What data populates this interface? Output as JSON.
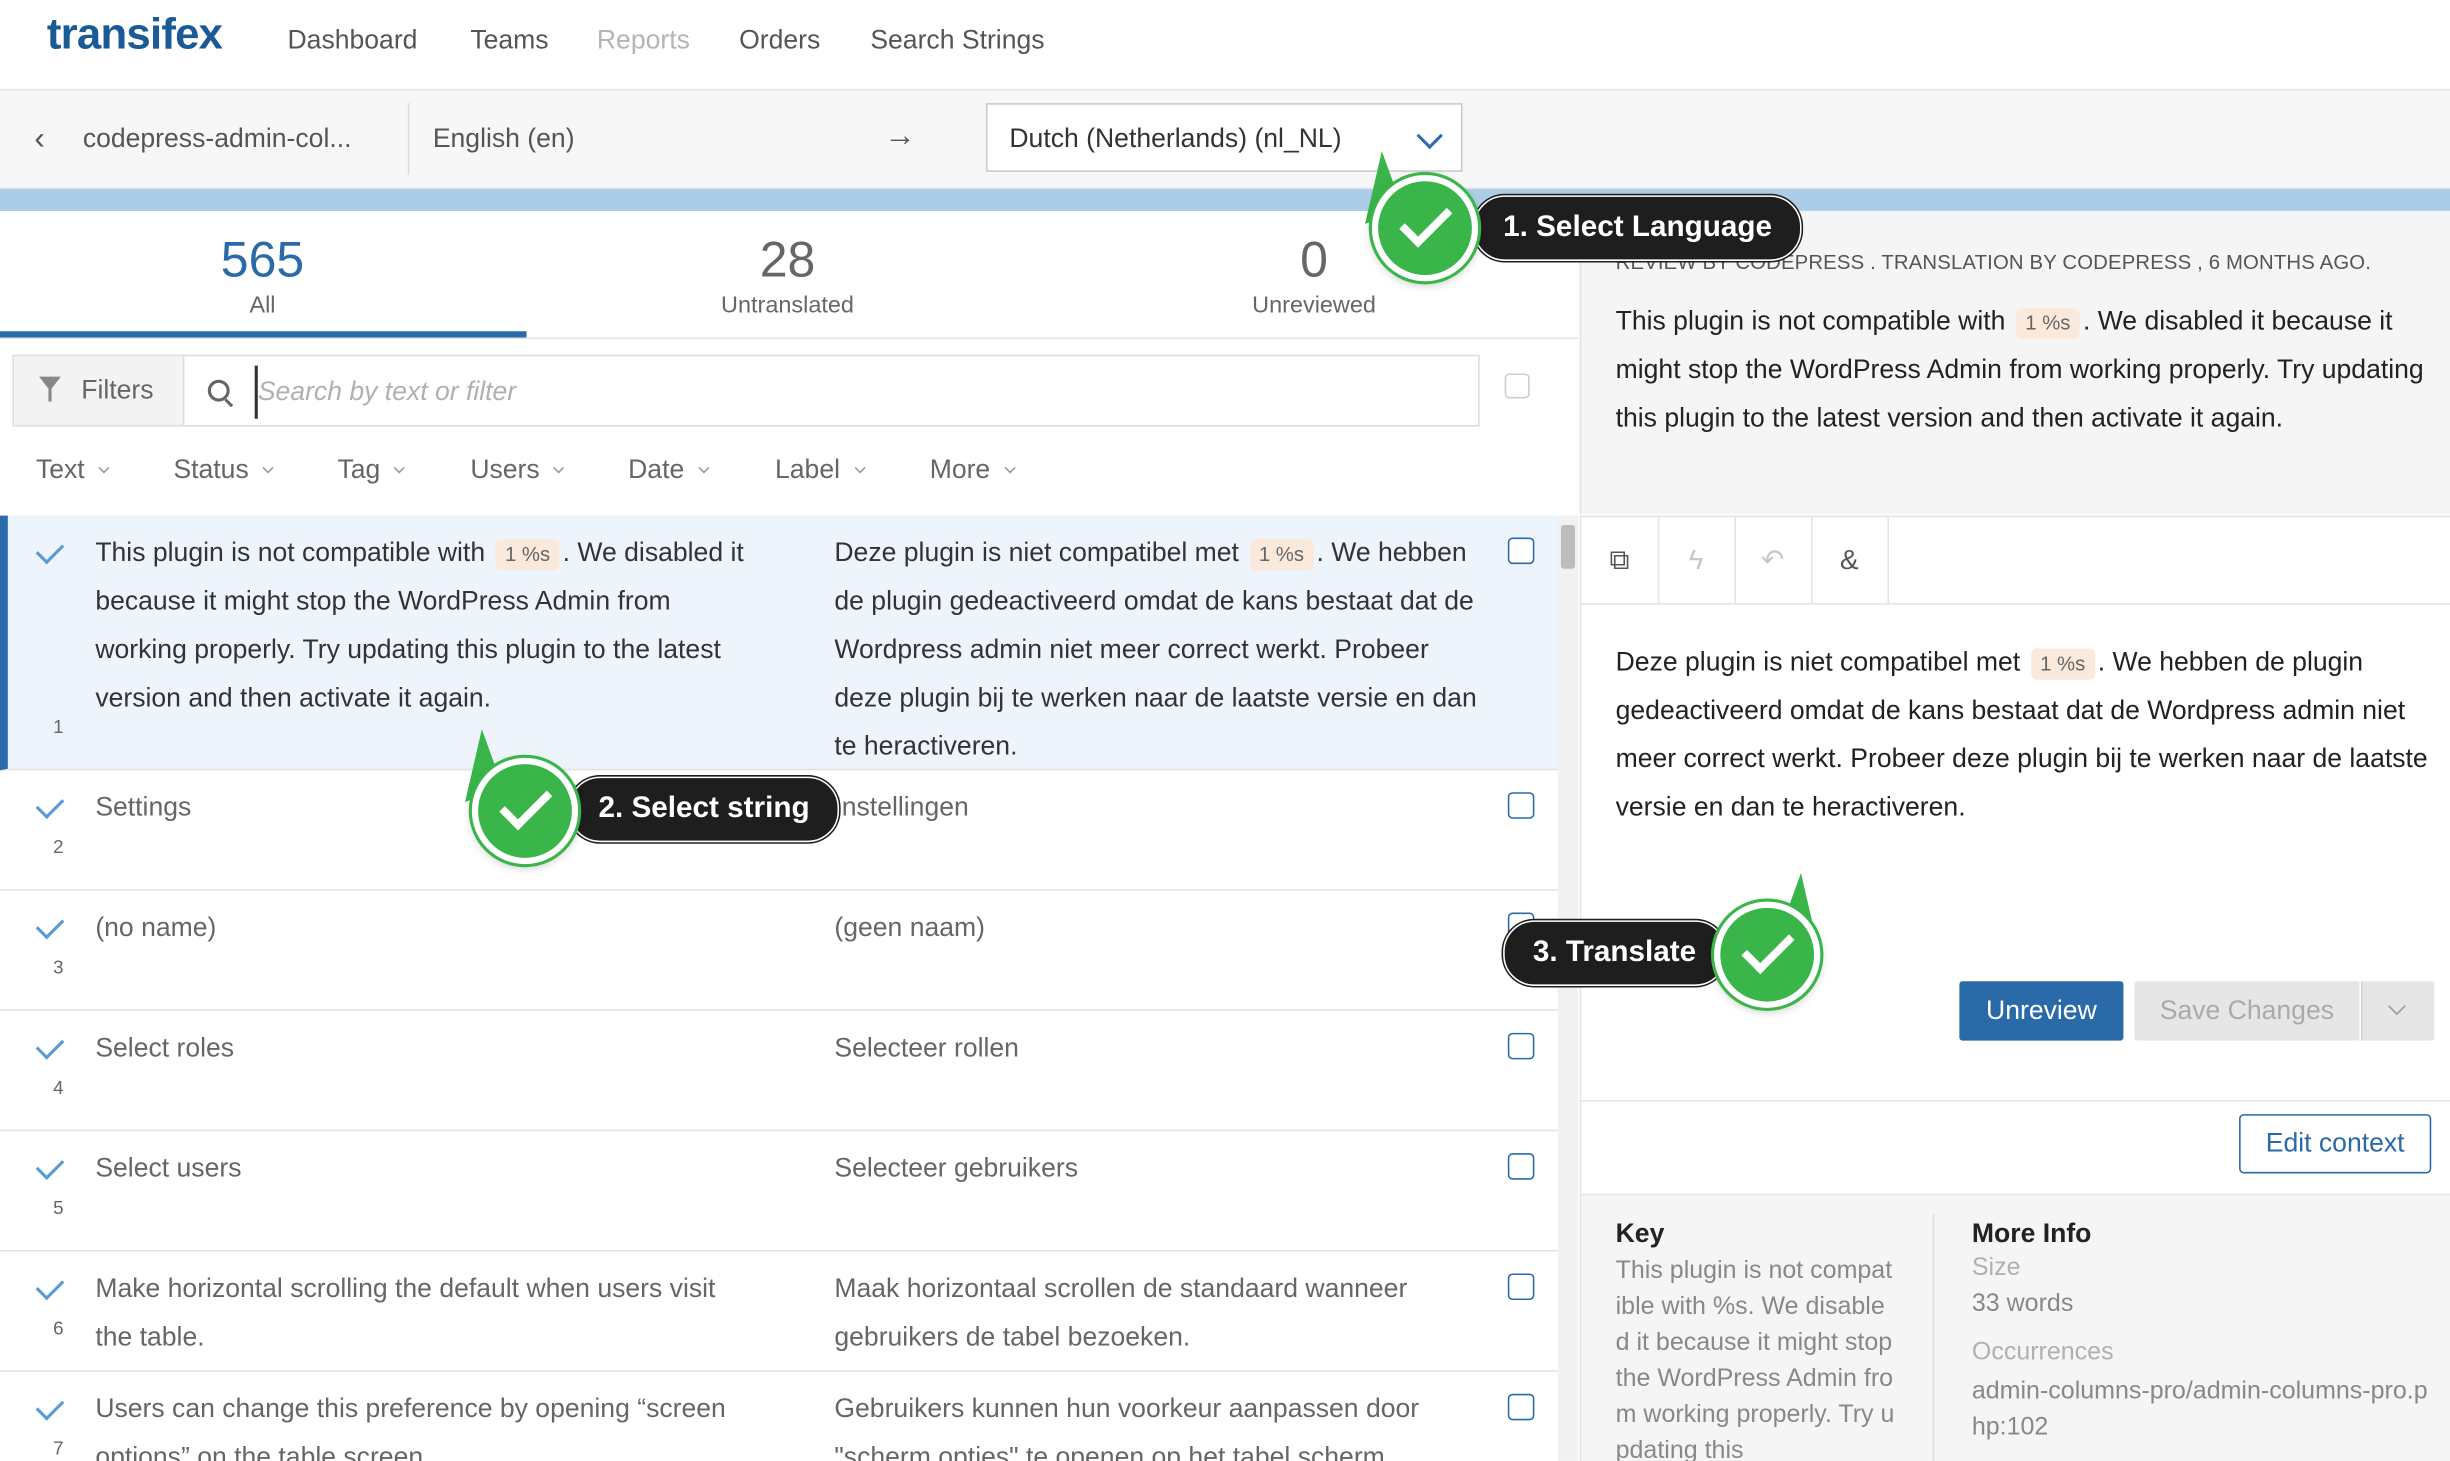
{
  "app": {
    "logo": "transifex",
    "nav": [
      "Dashboard",
      "Teams",
      "Reports",
      "Orders",
      "Search Strings"
    ]
  },
  "subbar": {
    "project": "codepress-admin-col...",
    "source_language": "English (en)",
    "arrow": "→",
    "target_language": "Dutch (Netherlands) (nl_NL)"
  },
  "tabs": [
    {
      "count": "565",
      "label": "All"
    },
    {
      "count": "28",
      "label": "Untranslated"
    },
    {
      "count": "0",
      "label": "Unreviewed"
    }
  ],
  "filters": {
    "button": "Filters",
    "search_placeholder": "Search by text or filter",
    "columns": [
      "Text",
      "Status",
      "Tag",
      "Users",
      "Date",
      "Label",
      "More"
    ]
  },
  "rows": [
    {
      "num": "1",
      "src_a": "This plugin is not compatible with ",
      "src_ph": "1 %s",
      "src_b": ". We disabled it because it might stop the WordPress Admin from working properly. Try updating this plugin to the latest version and then activate it again.",
      "trg_a": "Deze plugin is niet compatibel met ",
      "trg_ph": "1 %s",
      "trg_b": ". We hebben de plugin gedeactiveerd omdat de kans bestaat dat de Wordpress admin niet meer correct werkt. Probeer deze plugin bij te werken naar de laatste versie en dan te heractiveren."
    },
    {
      "num": "2",
      "src": "Settings",
      "trg": "Instellingen"
    },
    {
      "num": "3",
      "src": "(no name)",
      "trg": "(geen naam)"
    },
    {
      "num": "4",
      "src": "Select roles",
      "trg": "Selecteer rollen"
    },
    {
      "num": "5",
      "src": "Select users",
      "trg": "Selecteer gebruikers"
    },
    {
      "num": "6",
      "src": "Make horizontal scrolling the default when users visit the table.",
      "trg": "Maak horizontaal scrollen de standaard wanneer gebruikers de tabel bezoeken."
    },
    {
      "num": "7",
      "src": "Users can change this preference by opening “screen options” on the table screen.",
      "trg": "Gebruikers kunnen hun voorkeur aanpassen door \"scherm opties\" te openen op het tabel scherm."
    }
  ],
  "detail": {
    "review_meta": "REVIEW BY CODEPRESS . TRANSLATION BY CODEPRESS , 6 MONTHS AGO.",
    "source_a": "This plugin is not compatible with ",
    "source_ph": "1 %s",
    "source_b": ". We disabled it because it might stop the WordPress Admin from working properly. Try updating this plugin to the latest version and then activate it again.",
    "translation_a": "Deze plugin is niet compatibel met ",
    "translation_ph": "1 %s",
    "translation_b": ". We hebben de plugin gedeactiveerd omdat de kans bestaat dat de Wordpress admin niet meer correct werkt. Probeer deze plugin bij te werken naar de laatste versie en dan te heractiveren.",
    "unreview": "Unreview",
    "save": "Save Changes",
    "edit_context": "Edit context"
  },
  "info": {
    "key_title": "Key",
    "key_value": "This plugin is not compatible with %s. We disabled it because it might stop the WordPress Admin from working properly. Try updating this",
    "more_title": "More Info",
    "size_label": "Size",
    "size_value": "33 words",
    "occ_label": "Occurrences",
    "occ_value": "admin-columns-pro/admin-columns-pro.php:102"
  },
  "callouts": [
    "1. Select Language",
    "2. Select string",
    "3. Translate"
  ],
  "colors": {
    "brand": "#1a5a96",
    "accent": "#2a6aa8",
    "callout_green": "#3ab54a",
    "placeholder_chip": "#fbe9dc"
  }
}
